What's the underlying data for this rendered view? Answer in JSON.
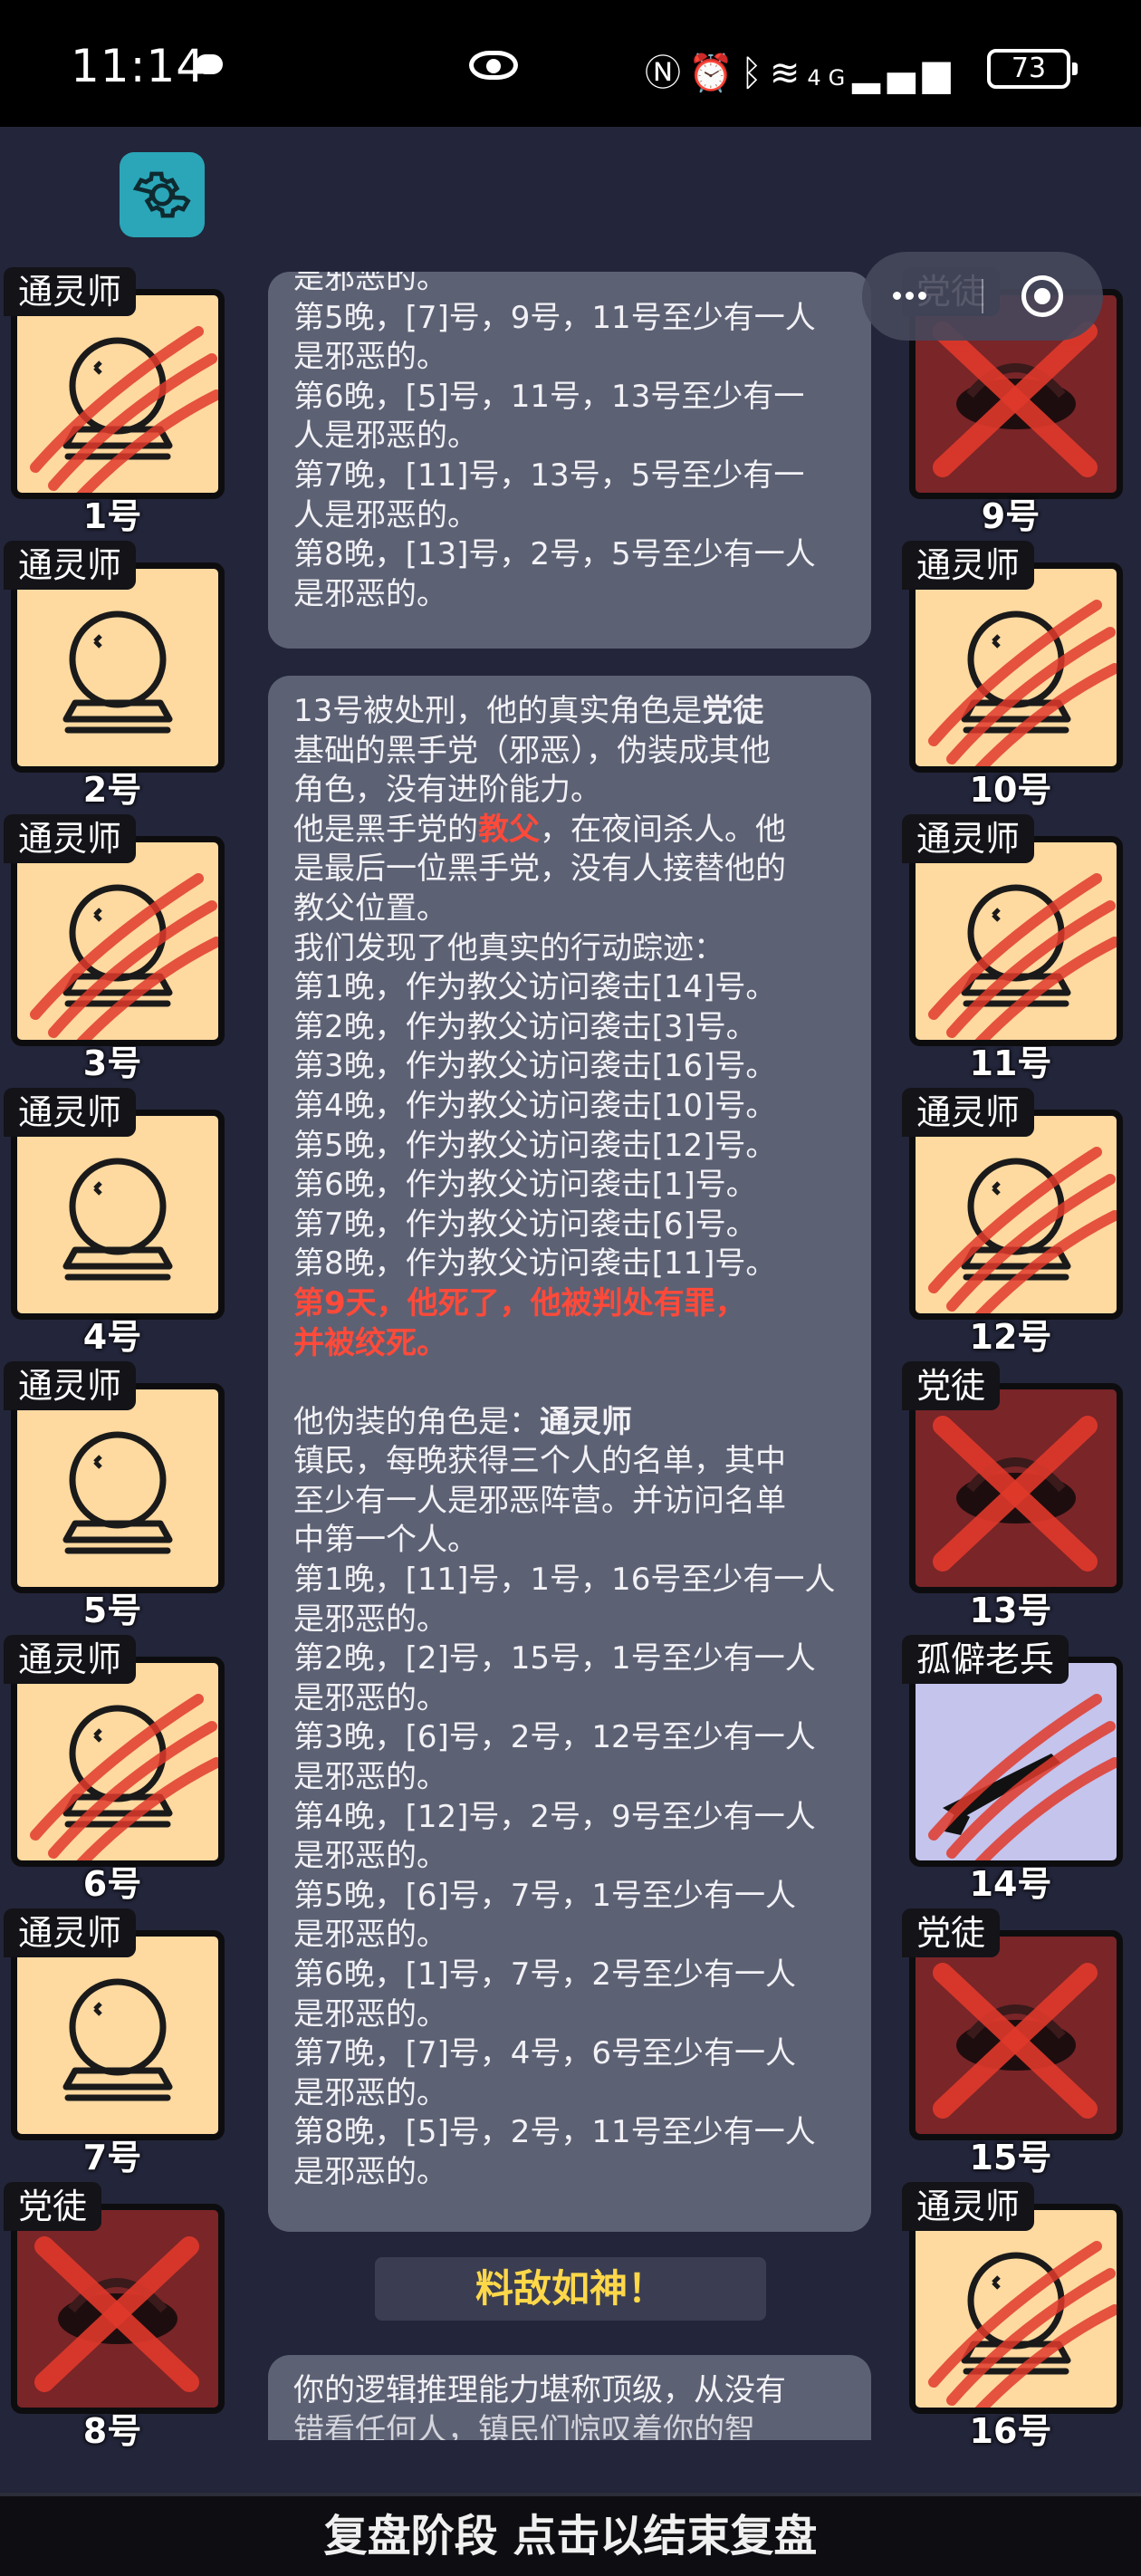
{
  "status_bar": {
    "time": "11:14",
    "network_text": "4G",
    "battery": "73"
  },
  "players": [
    {
      "num": "1号",
      "role": "通灵师",
      "type": "ball",
      "dead": "claw"
    },
    {
      "num": "2号",
      "role": "通灵师",
      "type": "ball",
      "dead": "none"
    },
    {
      "num": "3号",
      "role": "通灵师",
      "type": "ball",
      "dead": "claw"
    },
    {
      "num": "4号",
      "role": "通灵师",
      "type": "ball",
      "dead": "none"
    },
    {
      "num": "5号",
      "role": "通灵师",
      "type": "ball",
      "dead": "none"
    },
    {
      "num": "6号",
      "role": "通灵师",
      "type": "ball",
      "dead": "claw"
    },
    {
      "num": "7号",
      "role": "通灵师",
      "type": "ball",
      "dead": "none"
    },
    {
      "num": "8号",
      "role": "党徒",
      "type": "evil",
      "dead": "cross"
    },
    {
      "num": "9号",
      "role": "党徒",
      "type": "evil",
      "dead": "cross"
    },
    {
      "num": "10号",
      "role": "通灵师",
      "type": "ball",
      "dead": "claw"
    },
    {
      "num": "11号",
      "role": "通灵师",
      "type": "ball",
      "dead": "claw"
    },
    {
      "num": "12号",
      "role": "通灵师",
      "type": "ball",
      "dead": "claw"
    },
    {
      "num": "13号",
      "role": "党徒",
      "type": "evil",
      "dead": "cross"
    },
    {
      "num": "14号",
      "role": "孤僻老兵",
      "type": "vet",
      "dead": "claw"
    },
    {
      "num": "15号",
      "role": "党徒",
      "type": "evil",
      "dead": "cross"
    },
    {
      "num": "16号",
      "role": "通灵师",
      "type": "ball",
      "dead": "claw"
    }
  ],
  "log_top": [
    "是邪恶的。",
    "第5晚，[7]号，9号，11号至少有一人",
    "是邪恶的。",
    "第6晚，[5]号，11号，13号至少有一",
    "人是邪恶的。",
    "第7晚，[11]号，13号，5号至少有一",
    "人是邪恶的。",
    "第8晚，[13]号，2号，5号至少有一人",
    "是邪恶的。"
  ],
  "log_main": {
    "line1_a": "13号被处刑，他的真实角色是",
    "line1_role": "党徒",
    "line2": "基础的黑手党（邪恶），伪装成其他",
    "line3": "角色，没有进阶能力。",
    "line4_a": "他是黑手党的",
    "line4_role": "教父",
    "line4_b": "，在夜间杀人。他",
    "line5": "是最后一位黑手党，没有人接替他的",
    "line6": "教父位置。",
    "line7": "我们发现了他真实的行动踪迹：",
    "actions": [
      "第1晚，作为教父访问袭击[14]号。",
      "第2晚，作为教父访问袭击[3]号。",
      "第3晚，作为教父访问袭击[16]号。",
      "第4晚，作为教父访问袭击[10]号。",
      "第5晚，作为教父访问袭击[12]号。",
      "第6晚，作为教父访问袭击[1]号。",
      "第7晚，作为教父访问袭击[6]号。",
      "第8晚，作为教父访问袭击[11]号。"
    ],
    "death1": "第9天，他死了，他被判处有罪，",
    "death2": "并被绞死。",
    "disguise_a": "他伪装的角色是：",
    "disguise_role": "通灵师",
    "desc": [
      "镇民，每晚获得三个人的名单，其中",
      "至少有一人是邪恶阵营。并访问名单",
      "中第一个人。"
    ],
    "fake_results": [
      "第1晚，[11]号，1号，16号至少有一人",
      "是邪恶的。",
      "第2晚，[2]号，15号，1号至少有一人",
      "是邪恶的。",
      "第3晚，[6]号，2号，12号至少有一人",
      "是邪恶的。",
      "第4晚，[12]号，2号，9号至少有一人",
      "是邪恶的。",
      "第5晚，[6]号，7号，1号至少有一人",
      "是邪恶的。",
      "第6晚，[1]号，7号，2号至少有一人",
      "是邪恶的。",
      "第7晚，[7]号，4号，6号至少有一人",
      "是邪恶的。",
      "第8晚，[5]号，2号，11号至少有一人",
      "是邪恶的。"
    ]
  },
  "achievement": "料敌如神！",
  "log_bottom": [
    "你的逻辑推理能力堪称顶级，从没有",
    "错看任何人，镇民们惊叹着你的智"
  ],
  "bottom_bar": "复盘阶段 点击以结束复盘",
  "icons": {
    "settings": "gear-icon",
    "capsule_more": "more-dots-icon",
    "capsule_close": "target-close-icon"
  },
  "colors": {
    "bg": "#23253a",
    "card_good": "#fed9a0",
    "card_evil": "#7a2528",
    "card_vet": "#c4c4ec",
    "highlight_red": "#ff4a3a",
    "gold": "#ffd84a",
    "settings": "#2aa6b8"
  }
}
